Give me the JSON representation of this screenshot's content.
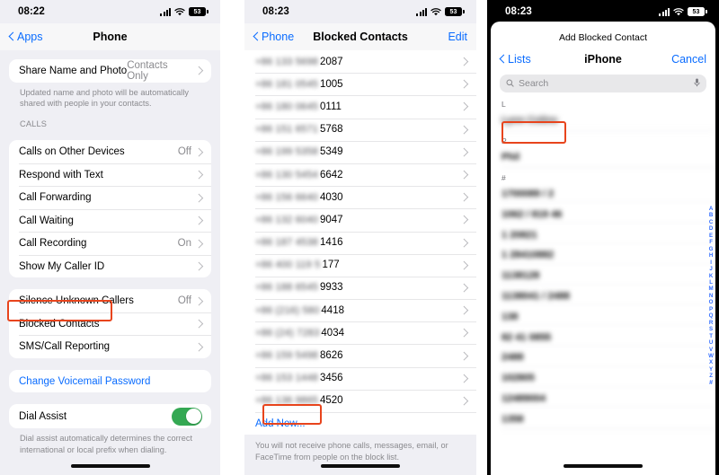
{
  "panel1": {
    "name": "phone-settings",
    "status": {
      "time": "08:22",
      "battery": "53",
      "signal_icon": "cellular-bars-icon",
      "wifi_icon": "wifi-icon",
      "battery_icon": "battery-icon"
    },
    "nav": {
      "back_label": "Apps",
      "title": "Phone"
    },
    "share_group": {
      "label": "Share Name and Photo",
      "value": "Contacts Only",
      "footnote": "Updated name and photo will be automatically shared with people in your contacts."
    },
    "calls_header": "CALLS",
    "calls_rows": [
      {
        "label": "Calls on Other Devices",
        "value": "Off"
      },
      {
        "label": "Respond with Text",
        "value": ""
      },
      {
        "label": "Call Forwarding",
        "value": ""
      },
      {
        "label": "Call Waiting",
        "value": ""
      },
      {
        "label": "Call Recording",
        "value": "On"
      },
      {
        "label": "Show My Caller ID",
        "value": ""
      }
    ],
    "block_rows": [
      {
        "label": "Silence Unknown Callers",
        "value": "Off"
      },
      {
        "label": "Blocked Contacts",
        "value": ""
      },
      {
        "label": "SMS/Call Reporting",
        "value": ""
      }
    ],
    "voicemail_row": {
      "label": "Change Voicemail Password"
    },
    "dial_assist": {
      "label": "Dial Assist",
      "toggle_state": "on",
      "footnote": "Dial assist automatically determines the correct international or local prefix when dialing."
    },
    "highlight_color": "#e8441c"
  },
  "panel2": {
    "name": "blocked-contacts",
    "status": {
      "time": "08:23",
      "battery": "53"
    },
    "nav": {
      "back_label": "Phone",
      "title": "Blocked Contacts",
      "edit_label": "Edit"
    },
    "rows": [
      {
        "masked": "+86 133 5698",
        "tail": "2087"
      },
      {
        "masked": "+86 181 0545",
        "tail": "1005"
      },
      {
        "masked": "+86 180 0645",
        "tail": "0111"
      },
      {
        "masked": "+86 151 6571",
        "tail": "5768"
      },
      {
        "masked": "+86 199 5358",
        "tail": "5349"
      },
      {
        "masked": "+86 130 5454",
        "tail": "6642"
      },
      {
        "masked": "+86 156 6640",
        "tail": "4030"
      },
      {
        "masked": "+86 132 6040",
        "tail": "9047"
      },
      {
        "masked": "+86 187 4538",
        "tail": "1416"
      },
      {
        "masked": "+86 400 119 5",
        "tail": "177"
      },
      {
        "masked": "+86 188 6545",
        "tail": "9933"
      },
      {
        "masked": "+86 (216) 580",
        "tail": "4418"
      },
      {
        "masked": "+86 (24) 7283",
        "tail": "4034"
      },
      {
        "masked": "+86 159 5498",
        "tail": "8626"
      },
      {
        "masked": "+86 153 1448",
        "tail": "3456"
      },
      {
        "masked": "+86 136 9865",
        "tail": "4520"
      }
    ],
    "add_new_label": "Add New...",
    "footnote": "You will not receive phone calls, messages, email, or FaceTime from people on the block list.",
    "highlight_color": "#e8441c"
  },
  "panel3": {
    "name": "add-blocked-contact",
    "status": {
      "time": "08:23",
      "battery": "53"
    },
    "sheet_title": "Add Blocked Contact",
    "nav": {
      "back_label": "Lists",
      "title": "iPhone",
      "cancel_label": "Cancel"
    },
    "search": {
      "placeholder": "Search",
      "icon": "search-icon",
      "mic_icon": "microphone-icon"
    },
    "sections": [
      {
        "header": "L",
        "contacts": [
          {
            "name": "Lynn Colins",
            "blur": "light",
            "highlighted": true
          }
        ]
      },
      {
        "header": "P",
        "contacts": [
          {
            "name": "Phil",
            "blur": "heavy",
            "highlighted": false
          }
        ]
      },
      {
        "header": "#",
        "contacts": [
          {
            "name": "1700089 / 2",
            "blur": "heavy",
            "highlighted": false
          },
          {
            "name": "1062 / 819 46",
            "blur": "heavy",
            "highlighted": false
          },
          {
            "name": "1 20821",
            "blur": "heavy",
            "highlighted": false
          },
          {
            "name": "1 28410882",
            "blur": "heavy",
            "highlighted": false
          },
          {
            "name": "1138128",
            "blur": "heavy",
            "highlighted": false
          },
          {
            "name": "1138041 / 2488",
            "blur": "heavy",
            "highlighted": false
          },
          {
            "name": "138",
            "blur": "heavy",
            "highlighted": false
          },
          {
            "name": "82 41 0855",
            "blur": "heavy",
            "highlighted": false
          },
          {
            "name": "2488",
            "blur": "heavy",
            "highlighted": false
          },
          {
            "name": "102805",
            "blur": "heavy",
            "highlighted": false
          },
          {
            "name": "12489004",
            "blur": "heavy",
            "highlighted": false
          },
          {
            "name": "1358",
            "blur": "heavy",
            "highlighted": false
          }
        ]
      }
    ],
    "alpha_index": [
      "A",
      "B",
      "C",
      "D",
      "E",
      "F",
      "G",
      "H",
      "I",
      "J",
      "K",
      "L",
      "M",
      "N",
      "O",
      "P",
      "Q",
      "R",
      "S",
      "T",
      "U",
      "V",
      "W",
      "X",
      "Y",
      "Z",
      "#"
    ],
    "highlight_color": "#e8441c"
  }
}
